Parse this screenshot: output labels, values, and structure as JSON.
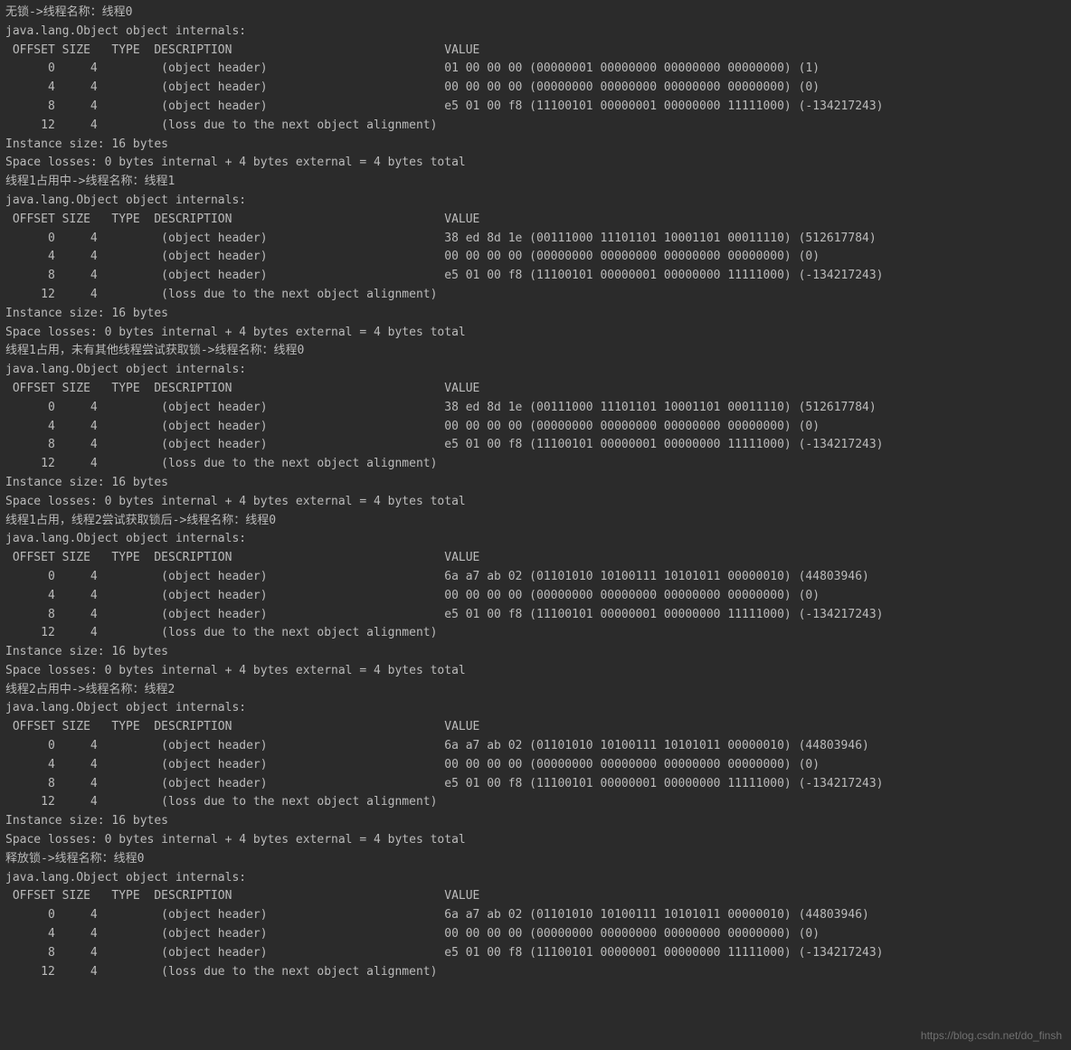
{
  "watermark": "https://blog.csdn.net/do_finsh",
  "common": {
    "internals_line": "java.lang.Object object internals:",
    "instance_size": "Instance size: 16 bytes",
    "space_losses": "Space losses: 0 bytes internal + 4 bytes external = 4 bytes total",
    "header": {
      "offset": "OFFSET",
      "size": "SIZE",
      "type": "TYPE",
      "description": "DESCRIPTION",
      "value": "VALUE"
    },
    "desc_header": "(object header)",
    "desc_loss": "(loss due to the next object alignment)"
  },
  "blocks": [
    {
      "title": "无锁->线程名称：线程0",
      "rows": [
        {
          "offset": "0",
          "size": "4",
          "type": "",
          "desc": "(object header)",
          "value": "01 00 00 00 (00000001 00000000 00000000 00000000) (1)"
        },
        {
          "offset": "4",
          "size": "4",
          "type": "",
          "desc": "(object header)",
          "value": "00 00 00 00 (00000000 00000000 00000000 00000000) (0)"
        },
        {
          "offset": "8",
          "size": "4",
          "type": "",
          "desc": "(object header)",
          "value": "e5 01 00 f8 (11100101 00000001 00000000 11111000) (-134217243)"
        },
        {
          "offset": "12",
          "size": "4",
          "type": "",
          "desc": "(loss due to the next object alignment)",
          "value": ""
        }
      ]
    },
    {
      "title": "线程1占用中->线程名称：线程1",
      "rows": [
        {
          "offset": "0",
          "size": "4",
          "type": "",
          "desc": "(object header)",
          "value": "38 ed 8d 1e (00111000 11101101 10001101 00011110) (512617784)"
        },
        {
          "offset": "4",
          "size": "4",
          "type": "",
          "desc": "(object header)",
          "value": "00 00 00 00 (00000000 00000000 00000000 00000000) (0)"
        },
        {
          "offset": "8",
          "size": "4",
          "type": "",
          "desc": "(object header)",
          "value": "e5 01 00 f8 (11100101 00000001 00000000 11111000) (-134217243)"
        },
        {
          "offset": "12",
          "size": "4",
          "type": "",
          "desc": "(loss due to the next object alignment)",
          "value": ""
        }
      ]
    },
    {
      "title": "线程1占用，未有其他线程尝试获取锁->线程名称：线程0",
      "rows": [
        {
          "offset": "0",
          "size": "4",
          "type": "",
          "desc": "(object header)",
          "value": "38 ed 8d 1e (00111000 11101101 10001101 00011110) (512617784)"
        },
        {
          "offset": "4",
          "size": "4",
          "type": "",
          "desc": "(object header)",
          "value": "00 00 00 00 (00000000 00000000 00000000 00000000) (0)"
        },
        {
          "offset": "8",
          "size": "4",
          "type": "",
          "desc": "(object header)",
          "value": "e5 01 00 f8 (11100101 00000001 00000000 11111000) (-134217243)"
        },
        {
          "offset": "12",
          "size": "4",
          "type": "",
          "desc": "(loss due to the next object alignment)",
          "value": ""
        }
      ]
    },
    {
      "title": "线程1占用，线程2尝试获取锁后->线程名称：线程0",
      "rows": [
        {
          "offset": "0",
          "size": "4",
          "type": "",
          "desc": "(object header)",
          "value": "6a a7 ab 02 (01101010 10100111 10101011 00000010) (44803946)"
        },
        {
          "offset": "4",
          "size": "4",
          "type": "",
          "desc": "(object header)",
          "value": "00 00 00 00 (00000000 00000000 00000000 00000000) (0)"
        },
        {
          "offset": "8",
          "size": "4",
          "type": "",
          "desc": "(object header)",
          "value": "e5 01 00 f8 (11100101 00000001 00000000 11111000) (-134217243)"
        },
        {
          "offset": "12",
          "size": "4",
          "type": "",
          "desc": "(loss due to the next object alignment)",
          "value": ""
        }
      ]
    },
    {
      "title": "线程2占用中->线程名称：线程2",
      "rows": [
        {
          "offset": "0",
          "size": "4",
          "type": "",
          "desc": "(object header)",
          "value": "6a a7 ab 02 (01101010 10100111 10101011 00000010) (44803946)"
        },
        {
          "offset": "4",
          "size": "4",
          "type": "",
          "desc": "(object header)",
          "value": "00 00 00 00 (00000000 00000000 00000000 00000000) (0)"
        },
        {
          "offset": "8",
          "size": "4",
          "type": "",
          "desc": "(object header)",
          "value": "e5 01 00 f8 (11100101 00000001 00000000 11111000) (-134217243)"
        },
        {
          "offset": "12",
          "size": "4",
          "type": "",
          "desc": "(loss due to the next object alignment)",
          "value": ""
        }
      ]
    },
    {
      "title": "释放锁->线程名称：线程0",
      "rows": [
        {
          "offset": "0",
          "size": "4",
          "type": "",
          "desc": "(object header)",
          "value": "6a a7 ab 02 (01101010 10100111 10101011 00000010) (44803946)"
        },
        {
          "offset": "4",
          "size": "4",
          "type": "",
          "desc": "(object header)",
          "value": "00 00 00 00 (00000000 00000000 00000000 00000000) (0)"
        },
        {
          "offset": "8",
          "size": "4",
          "type": "",
          "desc": "(object header)",
          "value": "e5 01 00 f8 (11100101 00000001 00000000 11111000) (-134217243)"
        },
        {
          "offset": "12",
          "size": "4",
          "type": "",
          "desc": "(loss due to the next object alignment)",
          "value": ""
        }
      ],
      "truncated": true
    }
  ]
}
